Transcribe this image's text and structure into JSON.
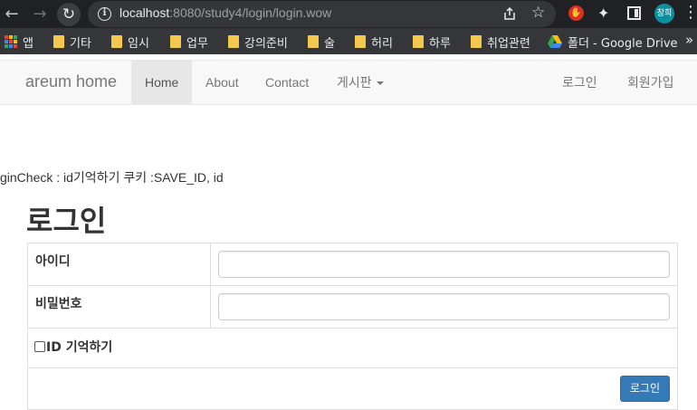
{
  "browser": {
    "url_host": "localhost",
    "url_rest": ":8080/study4/login/login.wow",
    "profile_initials": "창희"
  },
  "bookmarks": [
    {
      "label": "앱",
      "icon": "apps-grid-icon"
    },
    {
      "label": "기타",
      "icon": "folder-icon"
    },
    {
      "label": "임시",
      "icon": "folder-icon"
    },
    {
      "label": "업무",
      "icon": "folder-icon"
    },
    {
      "label": "강의준비",
      "icon": "folder-icon"
    },
    {
      "label": "술",
      "icon": "folder-icon"
    },
    {
      "label": "허리",
      "icon": "folder-icon"
    },
    {
      "label": "하루",
      "icon": "folder-icon"
    },
    {
      "label": "취업관련",
      "icon": "folder-icon"
    },
    {
      "label": "폴더 - Google Drive",
      "icon": "google-drive-icon"
    }
  ],
  "navbar": {
    "brand": "areum home",
    "items": [
      "Home",
      "About",
      "Contact",
      "게시판"
    ],
    "active": "Home",
    "right_items": [
      "로그인",
      "회원가입"
    ]
  },
  "debug_text": "ginCheck : id기억하기 쿠키 :SAVE_ID, id",
  "login": {
    "title": "로그인",
    "id_label": "아이디",
    "password_label": "비밀번호",
    "remember_label": "ID 기억하기",
    "submit_label": "로그인"
  },
  "colors": {
    "primary_button": "#337ab7",
    "navbar_bg": "#f8f8f8",
    "active_nav_bg": "#e7e7e7"
  }
}
